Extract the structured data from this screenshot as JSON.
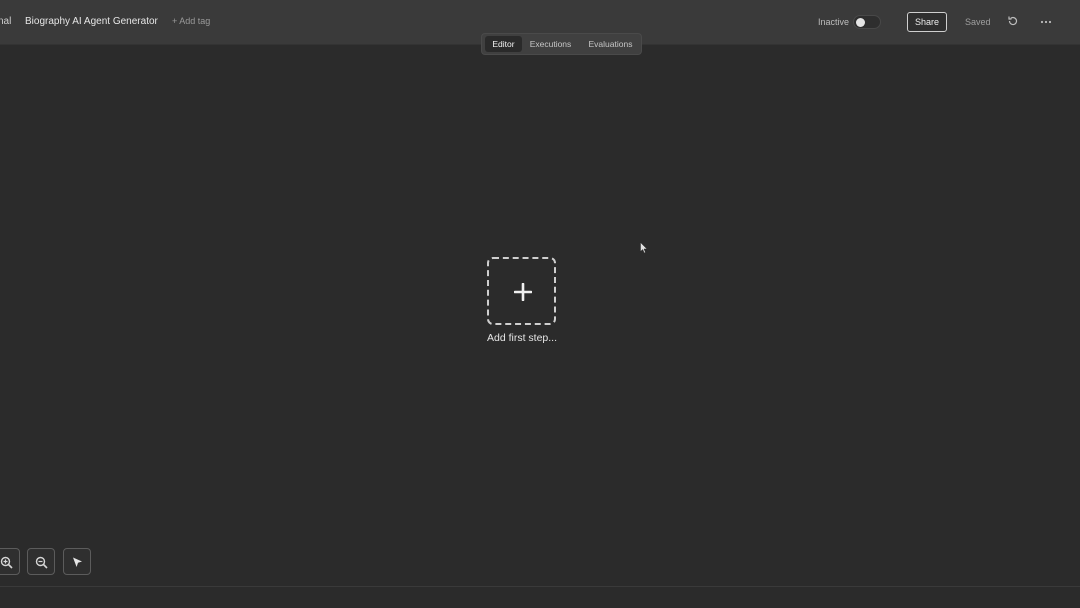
{
  "header": {
    "crumb_prefix": "nal",
    "title": "Biography AI Agent Generator",
    "add_tag": "+ Add tag",
    "active_label": "Inactive",
    "share_label": "Share",
    "saved_label": "Saved",
    "icons": [
      "history-icon",
      "more-icon"
    ]
  },
  "tabs": [
    {
      "label": "Editor",
      "selected": true
    },
    {
      "label": "Executions",
      "selected": false
    },
    {
      "label": "Evaluations",
      "selected": false
    }
  ],
  "canvas": {
    "add_step_label": "Add first step..."
  },
  "controls": {
    "icons": [
      "zoom-in-icon",
      "zoom-out-icon",
      "select-tool-icon"
    ]
  },
  "colors": {
    "background": "#2b2b2b",
    "header": "#3a3a3a",
    "accent": "#e6e6e6"
  }
}
